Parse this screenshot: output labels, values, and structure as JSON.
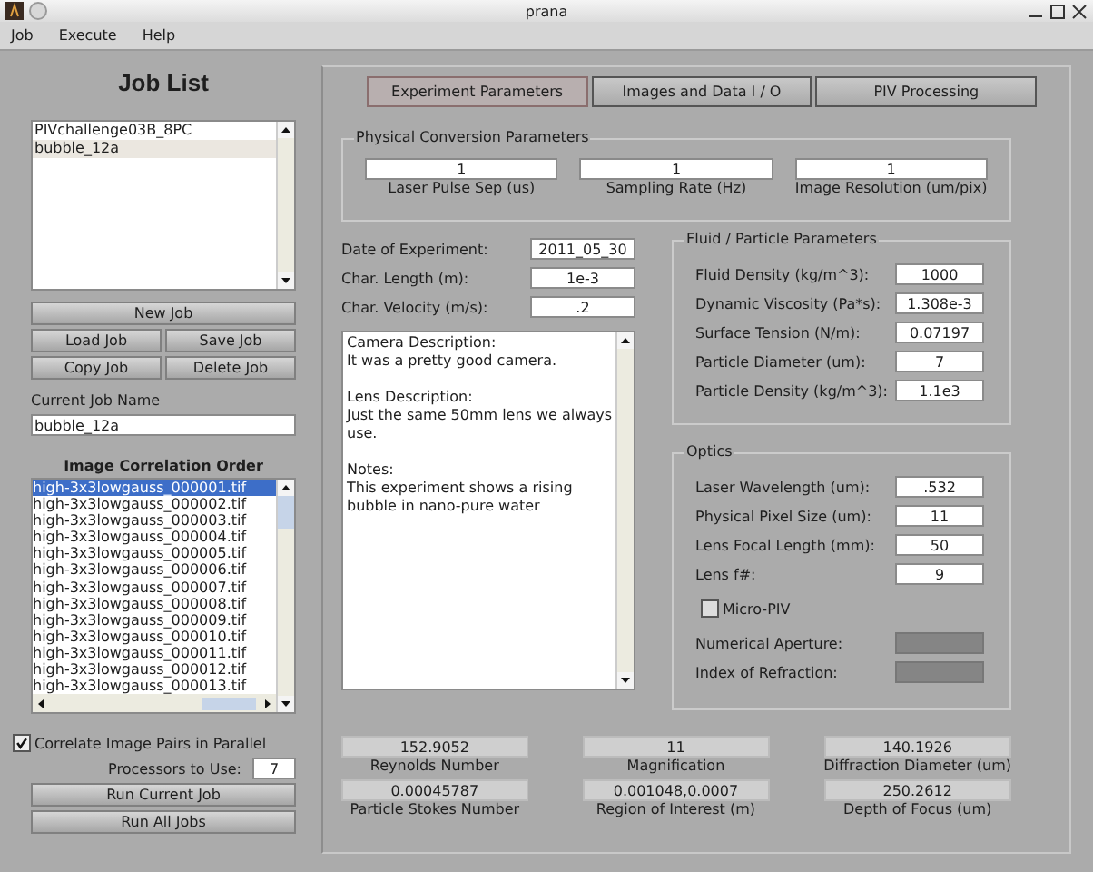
{
  "window": {
    "title": "prana"
  },
  "menu": [
    "Job",
    "Execute",
    "Help"
  ],
  "job_list": {
    "title": "Job List",
    "items": [
      {
        "label": "PIVchallenge03B_8PC",
        "selected": false
      },
      {
        "label": "bubble_12a",
        "selected": true
      }
    ]
  },
  "job_buttons": [
    "New Job",
    "Load Job",
    "Save Job",
    "Copy Job",
    "Delete Job"
  ],
  "current_job": {
    "label": "Current Job Name",
    "value": "bubble_12a"
  },
  "image_order": {
    "title": "Image Correlation Order",
    "items": [
      {
        "label": "high-3x3lowgauss_000001.tif",
        "selected": true
      },
      {
        "label": "high-3x3lowgauss_000002.tif",
        "selected": false
      },
      {
        "label": "high-3x3lowgauss_000003.tif",
        "selected": false
      },
      {
        "label": "high-3x3lowgauss_000004.tif",
        "selected": false
      },
      {
        "label": "high-3x3lowgauss_000005.tif",
        "selected": false
      },
      {
        "label": "high-3x3lowgauss_000006.tif",
        "selected": false
      },
      {
        "label": "high-3x3lowgauss_000007.tif",
        "selected": false
      },
      {
        "label": "high-3x3lowgauss_000008.tif",
        "selected": false
      },
      {
        "label": "high-3x3lowgauss_000009.tif",
        "selected": false
      },
      {
        "label": "high-3x3lowgauss_000010.tif",
        "selected": false
      },
      {
        "label": "high-3x3lowgauss_000011.tif",
        "selected": false
      },
      {
        "label": "high-3x3lowgauss_000012.tif",
        "selected": false
      },
      {
        "label": "high-3x3lowgauss_000013.tif",
        "selected": false
      }
    ]
  },
  "parallel": {
    "label": "Correlate Image Pairs in Parallel",
    "checked": true
  },
  "processors": {
    "label": "Processors to Use:",
    "value": "7"
  },
  "run_buttons": [
    "Run Current Job",
    "Run All Jobs"
  ],
  "tabs": [
    {
      "label": "Experiment Parameters",
      "selected": true
    },
    {
      "label": "Images and Data I / O",
      "selected": false
    },
    {
      "label": "PIV Processing",
      "selected": false
    }
  ],
  "physical": {
    "title": "Physical Conversion Parameters",
    "fields": [
      {
        "value": "1",
        "label": "Laser Pulse Sep (us)"
      },
      {
        "value": "1",
        "label": "Sampling Rate (Hz)"
      },
      {
        "value": "1",
        "label": "Image Resolution (um/pix)"
      }
    ]
  },
  "experiment_fields": [
    {
      "label": "Date of Experiment:",
      "value": "2011_05_30"
    },
    {
      "label": "Char. Length (m):",
      "value": "1e-3"
    },
    {
      "label": "Char. Velocity (m/s):",
      "value": ".2"
    }
  ],
  "notes": [
    {
      "heading": "Camera Description:",
      "text": "It was a pretty good camera."
    },
    {
      "heading": "Lens Description:",
      "text": "Just the same 50mm lens we always use."
    },
    {
      "heading": "Notes:",
      "text": "This experiment shows a rising bubble in nano-pure water"
    }
  ],
  "fluid": {
    "title": "Fluid / Particle Parameters",
    "fields": [
      {
        "label": "Fluid Density (kg/m^3):",
        "value": "1000"
      },
      {
        "label": "Dynamic Viscosity (Pa*s):",
        "value": "1.308e-3"
      },
      {
        "label": "Surface Tension (N/m):",
        "value": "0.07197"
      },
      {
        "label": "Particle Diameter (um):",
        "value": "7"
      },
      {
        "label": "Particle Density (kg/m^3):",
        "value": "1.1e3"
      }
    ]
  },
  "optics": {
    "title": "Optics",
    "fields": [
      {
        "label": "Laser Wavelength (um):",
        "value": ".532"
      },
      {
        "label": "Physical Pixel Size (um):",
        "value": "11"
      },
      {
        "label": "Lens Focal Length (mm):",
        "value": "50"
      },
      {
        "label": "Lens f#:",
        "value": "9"
      }
    ],
    "micro_piv": {
      "label": "Micro-PIV",
      "checked": false
    },
    "micro_fields": [
      {
        "label": "Numerical Aperture:",
        "disabled": true
      },
      {
        "label": "Index of Refraction:",
        "disabled": true
      }
    ]
  },
  "results": [
    {
      "value": "152.9052",
      "label": "Reynolds Number"
    },
    {
      "value": "11",
      "label": "Magnification"
    },
    {
      "value": "140.1926",
      "label": "Diffraction Diameter (um)"
    },
    {
      "value": "0.00045787",
      "label": "Particle Stokes Number"
    },
    {
      "value": "0.001048,0.0007",
      "label": "Region of Interest (m)"
    },
    {
      "value": "250.2612",
      "label": "Depth of Focus (um)"
    }
  ]
}
